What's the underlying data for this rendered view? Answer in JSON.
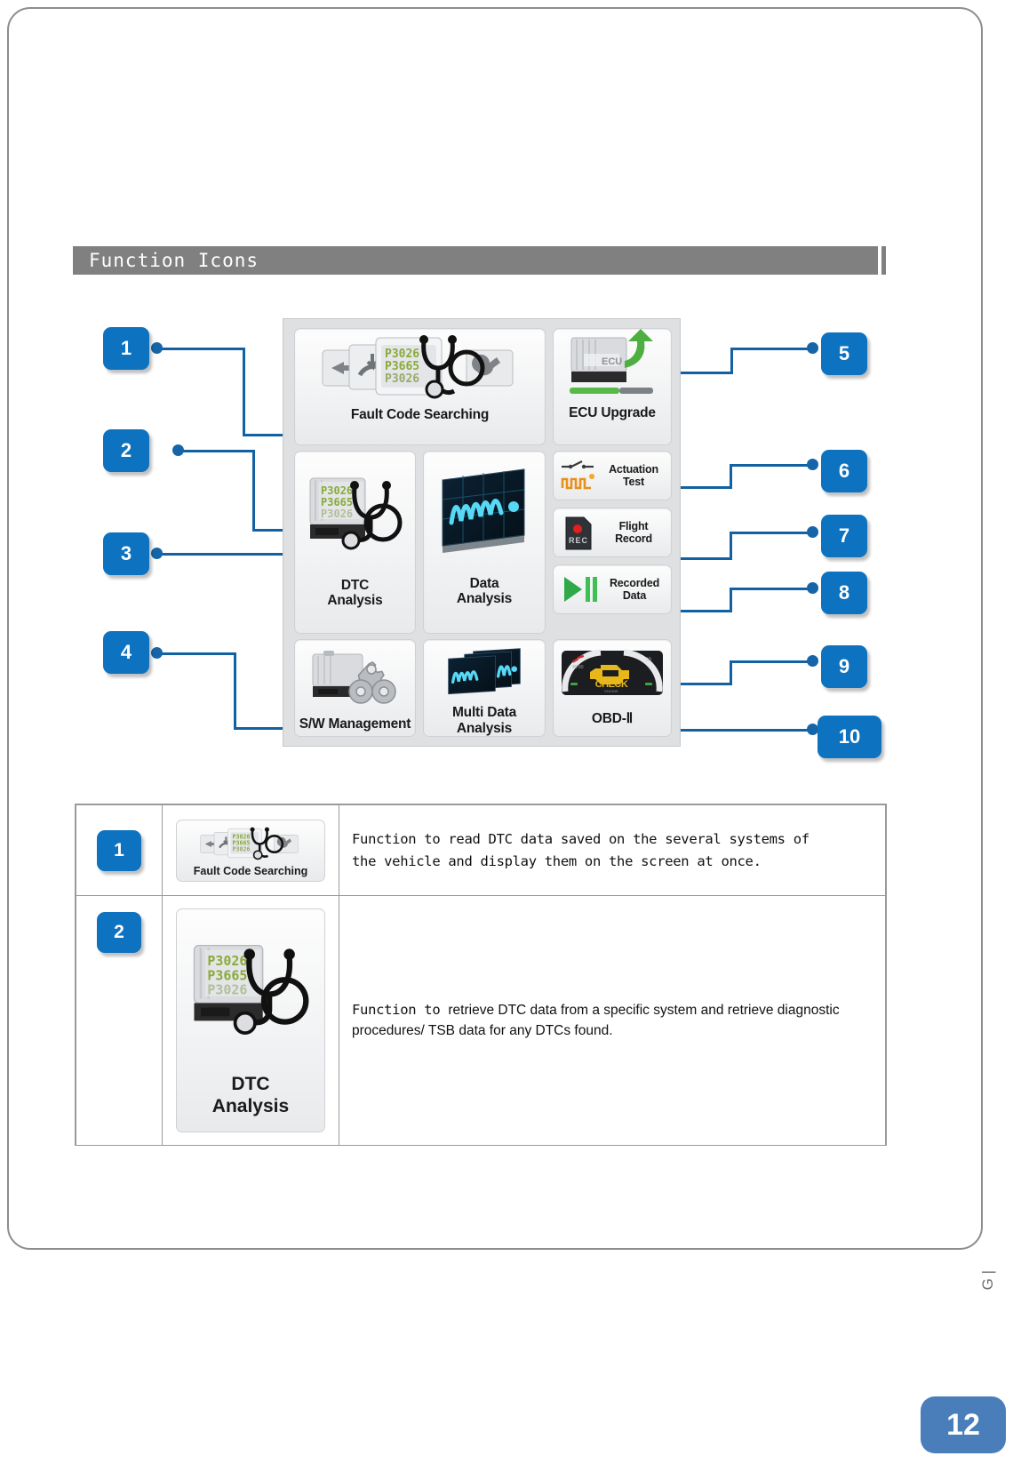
{
  "section": {
    "title": "Function  Icons"
  },
  "icon_grid": {
    "tiles": [
      {
        "id": "fault",
        "label": "Fault Code Searching",
        "icon": "ecu-stack-stethoscope-icon"
      },
      {
        "id": "ecu",
        "label": "ECU Upgrade",
        "icon": "ecu-green-arrow-icon"
      },
      {
        "id": "dtc",
        "label": "DTC\nAnalysis",
        "label_line1": "DTC",
        "label_line2": "Analysis",
        "icon": "ecu-stethoscope-icon"
      },
      {
        "id": "data",
        "label": "Data\nAnalysis",
        "label_line1": "Data",
        "label_line2": "Analysis",
        "icon": "oscilloscope-screen-icon"
      },
      {
        "id": "act",
        "label": "Actuation\nTest",
        "label_line1": "Actuation",
        "label_line2": "Test",
        "icon": "switch-pulse-icon"
      },
      {
        "id": "flight",
        "label": "Flight\nRecord",
        "label_line1": "Flight",
        "label_line2": "Record",
        "icon": "sd-card-rec-icon"
      },
      {
        "id": "rec",
        "label": "Recorded\nData",
        "label_line1": "Recorded",
        "label_line2": "Data",
        "icon": "play-pause-icon"
      },
      {
        "id": "sw",
        "label": "S/W Management",
        "icon": "ecu-gears-icon"
      },
      {
        "id": "multi",
        "label": "Multi Data Analysis",
        "icon": "multi-oscilloscope-icon"
      },
      {
        "id": "obd",
        "label": "OBD-Ⅱ",
        "icon": "cluster-check-engine-icon"
      }
    ]
  },
  "callouts": {
    "left": [
      {
        "n": "1"
      },
      {
        "n": "2"
      },
      {
        "n": "3"
      },
      {
        "n": "4"
      }
    ],
    "right": [
      {
        "n": "5"
      },
      {
        "n": "6"
      },
      {
        "n": "7"
      },
      {
        "n": "8"
      },
      {
        "n": "9"
      },
      {
        "n": "10"
      }
    ]
  },
  "desc_table": {
    "rows": [
      {
        "num": "1",
        "icon_label": "Fault Code Searching",
        "icon": "ecu-stack-stethoscope-icon",
        "text": "Function to read DTC data saved on the several systems of the vehicle and display them on the screen at once.",
        "text_line1": "Function to read DTC data saved on the several systems of",
        "text_line2": "the vehicle and display them on the screen at once.",
        "style": "mono"
      },
      {
        "num": "2",
        "icon_label_line1": "DTC",
        "icon_label_line2": "Analysis",
        "icon": "ecu-stethoscope-icon",
        "text_mono_prefix": "Function to ",
        "text_rest": "retrieve DTC data from a specific system and retrieve diagnostic procedures/ TSB data for any DTCs found.",
        "style": "mixed"
      }
    ]
  },
  "footer": {
    "side_mark": "G |",
    "page_number": "12"
  },
  "colors": {
    "title_bar": "#808080",
    "badge_blue": "#0d72bf",
    "leader_blue": "#1261a3",
    "page_badge": "#4a7ebb",
    "panel_bg": "#dfe0e2"
  }
}
